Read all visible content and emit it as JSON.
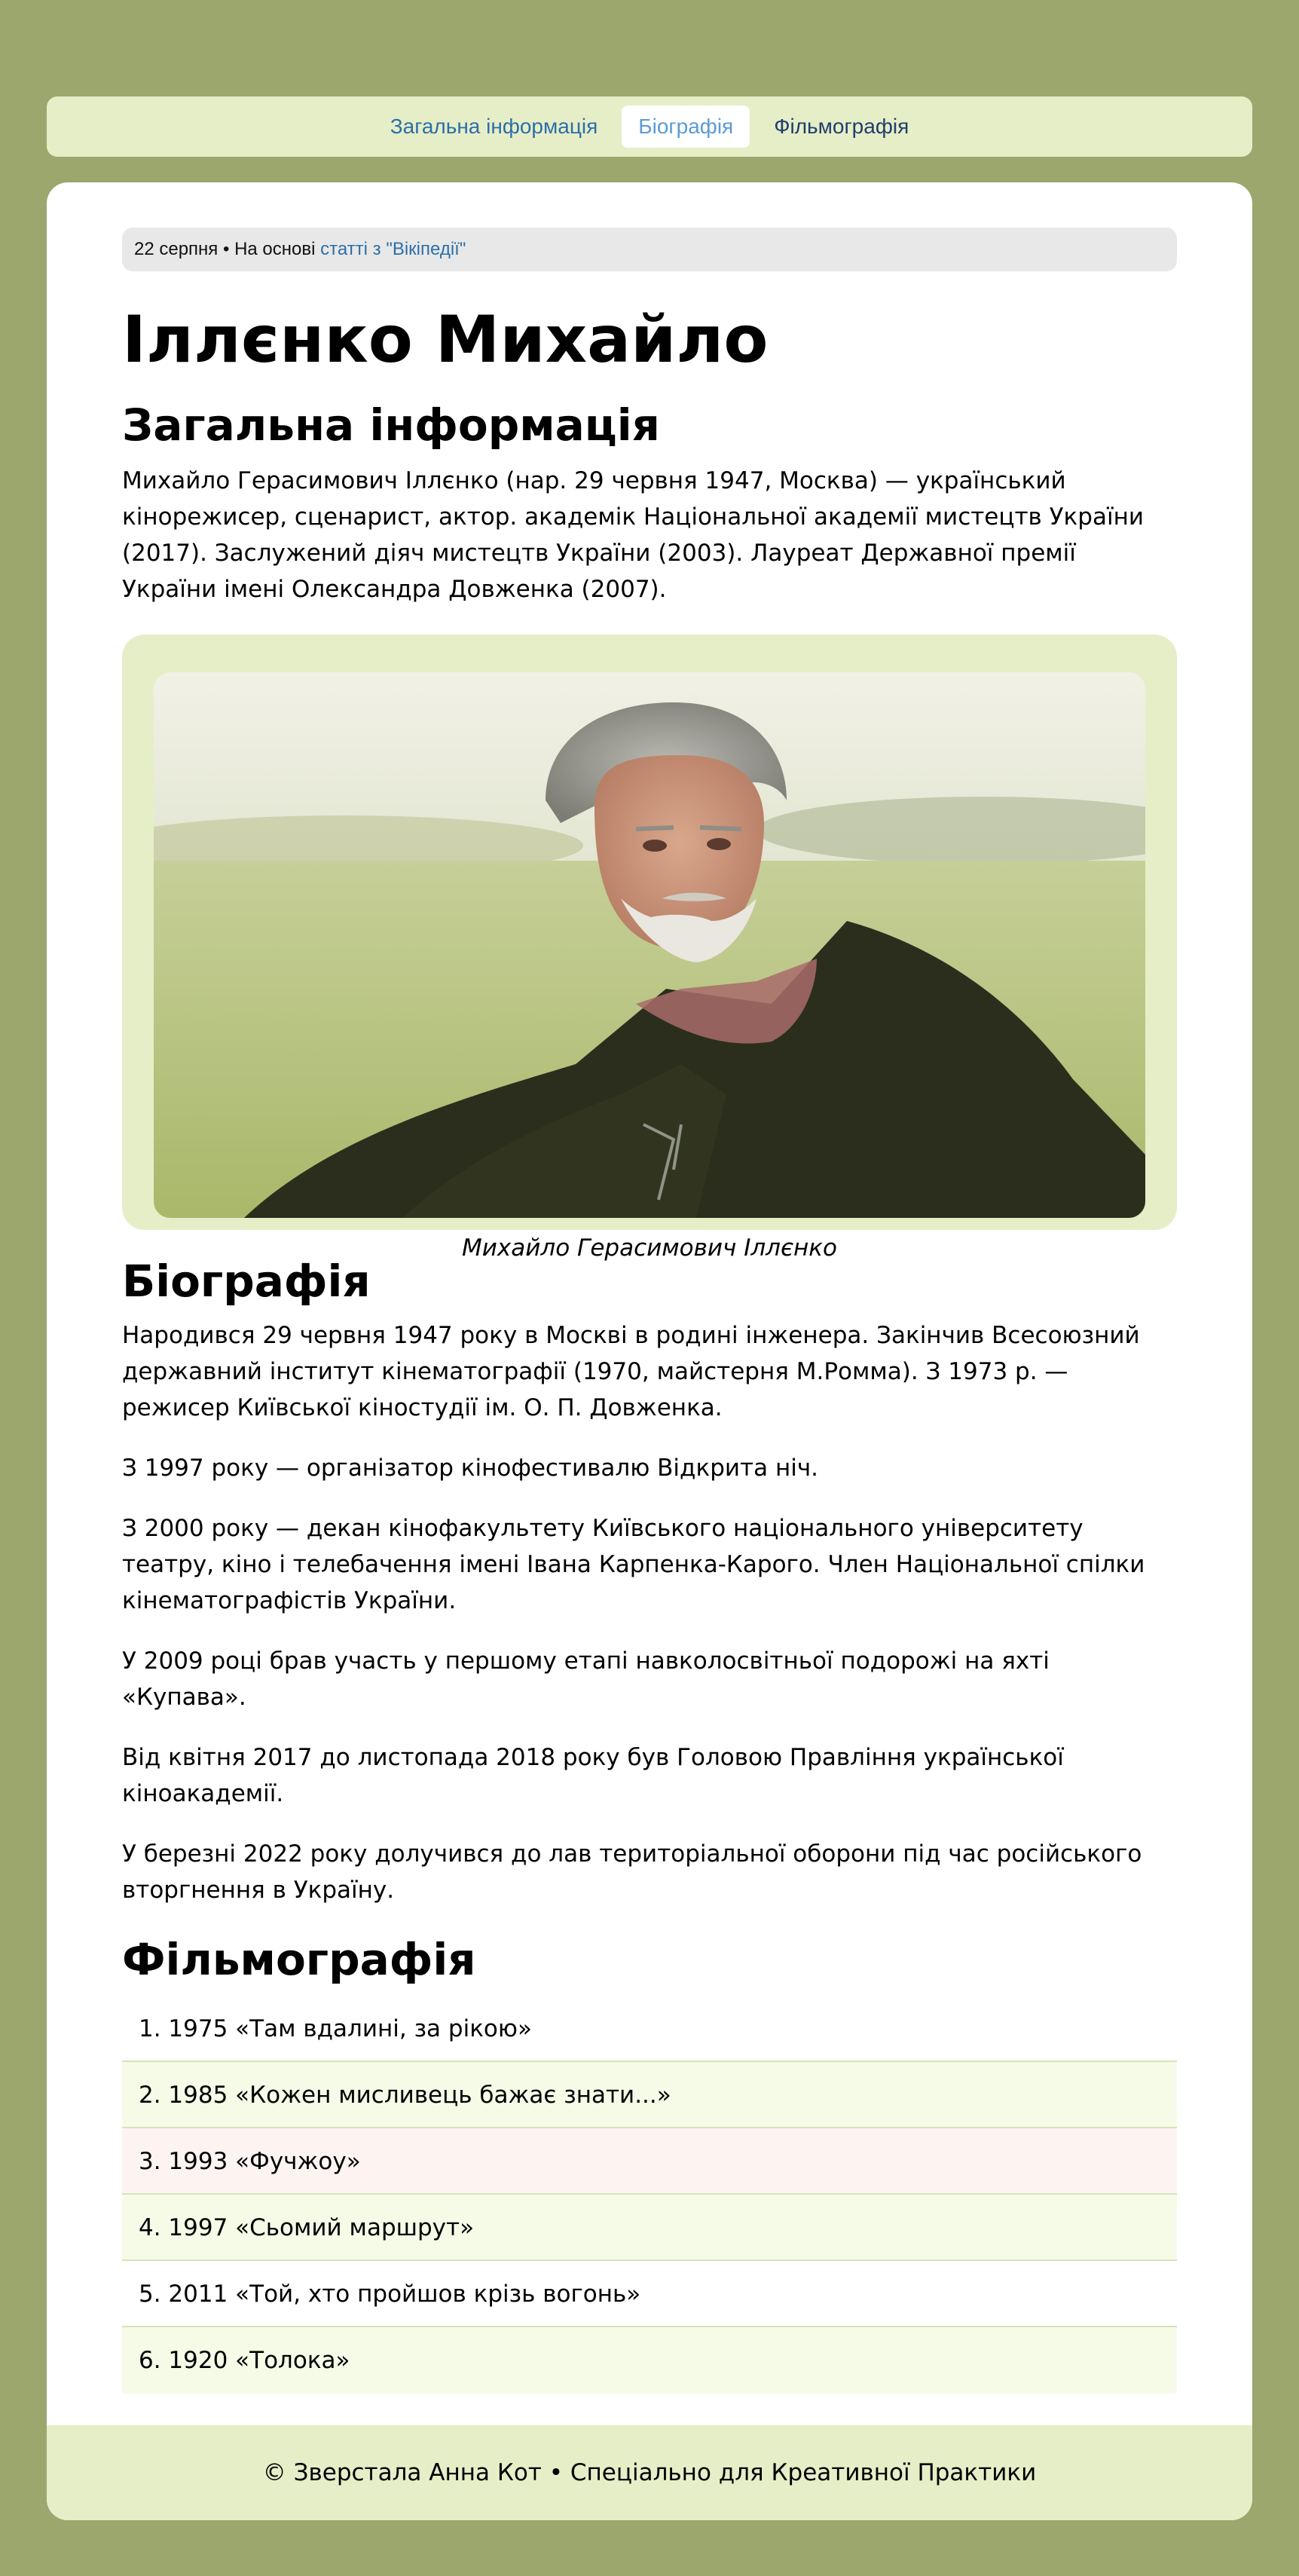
{
  "nav": {
    "items": [
      {
        "label": "Загальна інформація"
      },
      {
        "label": "Біографія"
      },
      {
        "label": "Фільмографія"
      }
    ]
  },
  "meta": {
    "date": "22 серпня",
    "separator": "•",
    "prefix": "На основі",
    "link": "статті з \"Вікіпедії\""
  },
  "page_title": "Іллєнко Михайло",
  "general": {
    "heading": "Загальна інформація",
    "text": "Михайло Герасимович Іллєнко (нар. 29 червня 1947, Москва) — український кінорежисер, сценарист, актор. академік Національної академії мистецтв України (2017). Заслужений діяч мистецтв України (2003). Лауреат Державної премії України імені Олександра Довженка (2007).",
    "caption": "Михайло Герасимович Іллєнко"
  },
  "bio": {
    "heading": "Біографія",
    "paragraphs": [
      "Народився 29 червня 1947 року в Москві в родині інженера. Закінчив Всесоюзний державний інститут кінематографії (1970, майстерня М.Ромма). З 1973 р. — режисер Київської кіностудії ім. О. П. Довженка.",
      "З 1997 року — організатор кінофестивалю Відкрита ніч.",
      "З 2000 року — декан кінофакультету Київського національного університету театру, кіно і телебачення імені Івана Карпенка-Карого. Член Національної спілки кінематографістів України.",
      "У 2009 році брав участь у першому етапі навколосвітньої подорожі на яхті «Купава».",
      "Від квітня 2017 до листопада 2018 року був Головою Правління української кіноакадемії.",
      "У березні 2022 року долучився до лав територіальної оборони під час російського вторгнення в Україну."
    ]
  },
  "films": {
    "heading": "Фільмографія",
    "items": [
      "1. 1975 «Там вдалині, за рікою»",
      "2. 1985 «Кожен мисливець бажає знати...»",
      "3. 1993 «Фучжоу»",
      "4. 1997 «Сьомий маршрут»",
      "5. 2011 «Той, хто пройшов крізь вогонь»",
      "6. 1920 «Толока»"
    ]
  },
  "footer": {
    "text": "© Зверстала Анна Кот • Спеціально для Креативної Практики"
  },
  "colors": {
    "page_bg": "#9ba76d",
    "panel_light_green": "#e6eec8",
    "link_blue": "#2d6fa8",
    "active_tab_text": "#5b9bd5",
    "row_green": "#f6fbe8",
    "row_pink": "#fdf4f2"
  }
}
